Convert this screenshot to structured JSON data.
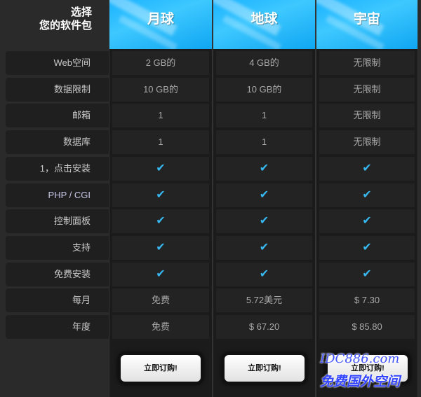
{
  "header": {
    "choose_line1": "选择",
    "choose_line2": "您的软件包"
  },
  "plans": [
    {
      "name": "月球",
      "order_label": "立即订购!"
    },
    {
      "name": "地球",
      "order_label": "立即订购!"
    },
    {
      "name": "宇宙",
      "order_label": "立即订购!"
    }
  ],
  "rows": [
    {
      "label": "Web空间",
      "values": [
        "2 GB的",
        "4 GB的",
        "无限制"
      ]
    },
    {
      "label": "数据限制",
      "values": [
        "10 GB的",
        "10 GB的",
        "无限制"
      ]
    },
    {
      "label": "邮箱",
      "values": [
        "1",
        "1",
        "无限制"
      ]
    },
    {
      "label": "数据库",
      "values": [
        "1",
        "1",
        "无限制"
      ]
    },
    {
      "label": "1，点击安装",
      "values": [
        "✔",
        "✔",
        "✔"
      ]
    },
    {
      "label": "PHP / CGI",
      "values": [
        "✔",
        "✔",
        "✔"
      ]
    },
    {
      "label": "控制面板",
      "values": [
        "✔",
        "✔",
        "✔"
      ]
    },
    {
      "label": "支持",
      "values": [
        "✔",
        "✔",
        "✔"
      ]
    },
    {
      "label": "免费安装",
      "values": [
        "✔",
        "✔",
        "✔"
      ]
    },
    {
      "label": "每月",
      "values": [
        "免费",
        "5.72美元",
        "$ 7.30"
      ]
    },
    {
      "label": "年度",
      "values": [
        "免费",
        "$ 67.20",
        "$ 85.80"
      ]
    }
  ],
  "watermark": {
    "line1": "IDC886.com",
    "line2": "免费国外空间"
  },
  "colors": {
    "accent": "#19b2ff",
    "check": "#37b8f0",
    "background": "#2b2b2b"
  },
  "icons": {
    "check": "check-icon"
  }
}
